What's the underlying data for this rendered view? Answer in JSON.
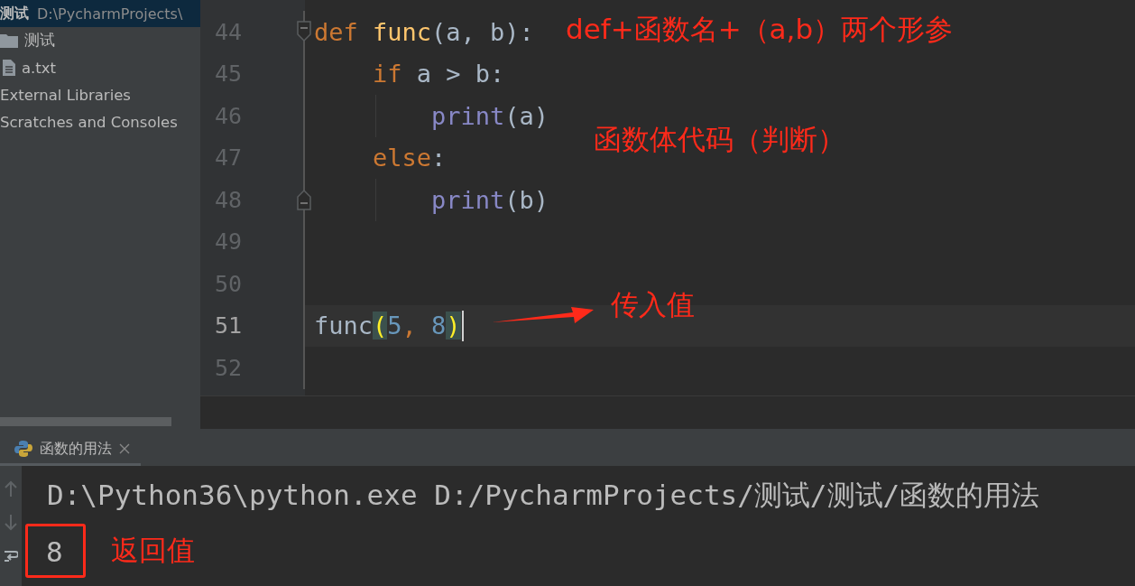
{
  "project": {
    "root": {
      "name": "测试",
      "path": "D:\\PycharmProjects\\",
      "selected": true
    },
    "items": [
      {
        "name": "测试",
        "kind": "folder"
      },
      {
        "name": "a.txt",
        "kind": "file"
      },
      {
        "name": "External Libraries",
        "kind": "plain"
      },
      {
        "name": "Scratches and Consoles",
        "kind": "plain"
      }
    ]
  },
  "editor": {
    "lines": [
      {
        "number": "44",
        "current": false,
        "caret": false,
        "tokens": [
          {
            "text": "def",
            "kind": "keyword"
          },
          {
            "text": "func",
            "kind": "function",
            "spaced": true
          },
          {
            "text": "(a, b):",
            "kind": "plain"
          }
        ],
        "children": [
          {
            "number": "45",
            "current": false,
            "caret": false,
            "tokens": [
              {
                "text": "if",
                "kind": "keyword"
              },
              {
                "text": "a > b:",
                "kind": "plain",
                "spaced": true
              }
            ],
            "children": [
              {
                "number": "46",
                "current": false,
                "caret": false,
                "tokens": [
                  {
                    "text": "print",
                    "kind": "builtin"
                  },
                  {
                    "text": "(a)",
                    "kind": "plain"
                  }
                ]
              }
            ]
          },
          {
            "number": "47",
            "current": false,
            "caret": false,
            "tokens": [
              {
                "text": "else",
                "kind": "keyword"
              },
              {
                "text": ":",
                "kind": "plain"
              }
            ],
            "children": [
              {
                "number": "48",
                "current": false,
                "caret": false,
                "tokens": [
                  {
                    "text": "print",
                    "kind": "builtin"
                  },
                  {
                    "text": "(b)",
                    "kind": "plain"
                  }
                ]
              }
            ]
          }
        ]
      },
      {
        "number": "49",
        "current": false,
        "caret": false
      },
      {
        "number": "50",
        "current": false,
        "caret": false
      },
      {
        "number": "51",
        "current": true,
        "caret": true,
        "tokens": [
          {
            "text": "func",
            "kind": "plain"
          },
          {
            "text": "(",
            "kind": "match"
          },
          {
            "text": "5",
            "kind": "number"
          },
          {
            "text": ",",
            "kind": "keyword"
          },
          {
            "text": "8",
            "kind": "number",
            "spaced": true
          },
          {
            "text": ")",
            "kind": "match"
          }
        ]
      },
      {
        "number": "52",
        "current": false,
        "caret": false
      }
    ],
    "annotations": [
      {
        "text": "def+函数名+（a,b）两个形参",
        "kind": "label"
      },
      {
        "text": "函数体代码（判断）",
        "kind": "label"
      },
      {
        "text": "传入值",
        "kind": "arrow-label"
      }
    ]
  },
  "run_panel": {
    "tab": {
      "label": "函数的用法",
      "selected": true
    },
    "lines": [
      {
        "text": "D:\\Python36\\python.exe D:/PycharmProjects/测试/测试/函数的用法",
        "kind": "command",
        "boxed": false
      },
      {
        "text": "8",
        "kind": "output",
        "boxed": true,
        "note": "返回值"
      }
    ]
  }
}
